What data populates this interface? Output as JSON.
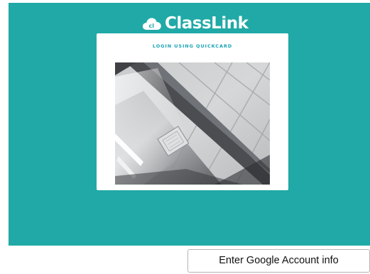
{
  "brand": {
    "logo_icon": "classlink-cloud-icon",
    "name": "ClassLink"
  },
  "quickcard": {
    "title": "LOGIN USING QUICKCARD",
    "camera_preview": "camera-feed"
  },
  "actions": {
    "google_button_label": "Enter Google Account info"
  },
  "colors": {
    "panel_background": "#20a9a6",
    "title_accent": "#1aa3b5",
    "card_background": "#ffffff"
  }
}
